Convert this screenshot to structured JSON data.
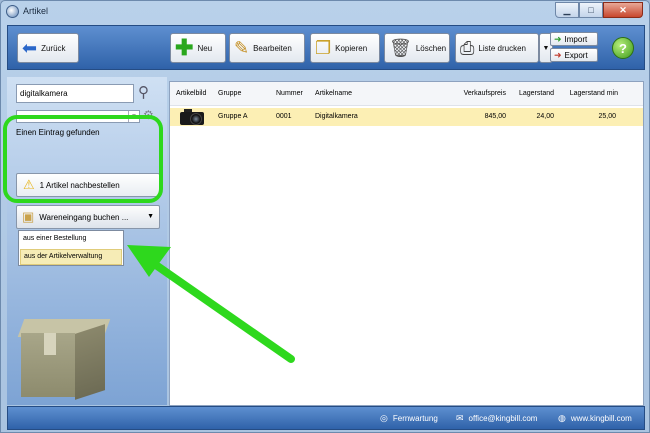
{
  "window": {
    "title": "Artikel"
  },
  "toolbar": {
    "back_label": "Zurück",
    "new_label": "Neu",
    "edit_label": "Bearbeiten",
    "copy_label": "Kopieren",
    "delete_label": "Löschen",
    "print_label": "Liste drucken",
    "import_label": "Import",
    "export_label": "Export"
  },
  "sidebar": {
    "search_value": "digitalkamera",
    "filter_value": "",
    "result_text": "Einen Eintrag gefunden",
    "reorder_label": "1 Artikel nachbestellen",
    "receipt_label": "Wareneingang buchen ...",
    "receipt_options": [
      "aus einer Bestellung",
      "aus der Artikelverwaltung"
    ]
  },
  "table": {
    "headers": [
      "Artikelbild",
      "Gruppe",
      "Nummer",
      "Artikelname",
      "Verkaufspreis",
      "Lagerstand",
      "Lagerstand min"
    ],
    "rows": [
      {
        "image": "camera-icon",
        "group": "Gruppe A",
        "number": "0001",
        "name": "Digitalkamera",
        "price": "845,00",
        "stock": "24,00",
        "stock_min": "25,00"
      }
    ]
  },
  "statusbar": {
    "remote": "Fernwartung",
    "email": "office@kingbill.com",
    "website": "www.kingbill.com"
  },
  "colors": {
    "highlight": "#2ed81d",
    "selected_row": "#fcefb4",
    "toolbar": "#3f73ba"
  }
}
